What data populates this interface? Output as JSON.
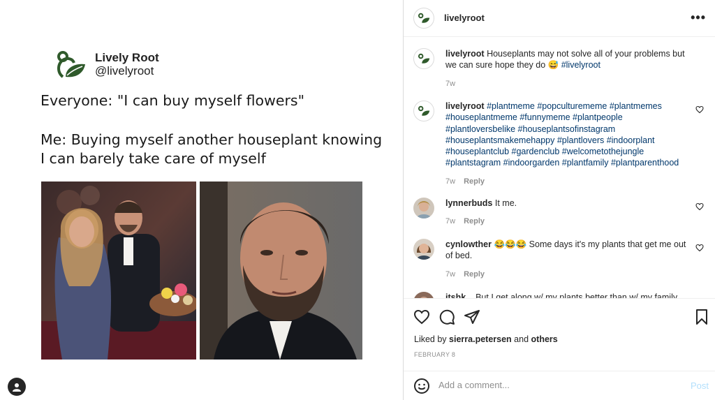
{
  "post_image": {
    "brand_name": "Lively Root",
    "brand_handle": "@livelyroot",
    "meme_line_1": "Everyone: \"I can buy myself flowers\"",
    "meme_line_2": "Me: Buying myself another houseplant knowing",
    "meme_line_3": "I can barely take care of myself",
    "logo_icon": "lively-root-leaf-logo",
    "photos": [
      "couple-at-event-photo",
      "man-closeup-photo"
    ]
  },
  "header": {
    "username": "livelyroot",
    "more_icon": "more-options-icon"
  },
  "comments": [
    {
      "username": "livelyroot",
      "text": "Houseplants may not solve all of your problems but we can sure hope they do 😅",
      "hashtag": "#livelyroot",
      "time": "7w"
    },
    {
      "username": "livelyroot",
      "hashtags": "#plantmeme #popculturememe #plantmemes #houseplantmeme #funnymeme #plantpeople #plantloversbelike #houseplantsofinstagram #houseplantsmakemehappy #plantlovers #indoorplant #houseplantclub #gardenclub #welcometothejungle #plantstagram #indoorgarden #plantfamily #plantparenthood",
      "time": "7w",
      "reply": "Reply"
    },
    {
      "username": "lynnerbuds",
      "text": "It me.",
      "time": "7w",
      "reply": "Reply"
    },
    {
      "username": "cynlowther",
      "text": "😂😂😂 Some days it's my plants that get me out of bed.",
      "time": "7w",
      "reply": "Reply"
    },
    {
      "username": "itshk...",
      "text": "But I get along w/ my plants better than w/ my family..."
    }
  ],
  "likes": {
    "prefix": "Liked by",
    "user": "sierra.petersen",
    "conj": "and",
    "others": "others"
  },
  "date": "FEBRUARY 8",
  "add_comment": {
    "placeholder": "Add a comment...",
    "post_label": "Post"
  },
  "colors": {
    "hashtag": "#00376b",
    "muted": "#8e8e8e",
    "post_disabled": "#b2dffc",
    "text": "#262626"
  }
}
